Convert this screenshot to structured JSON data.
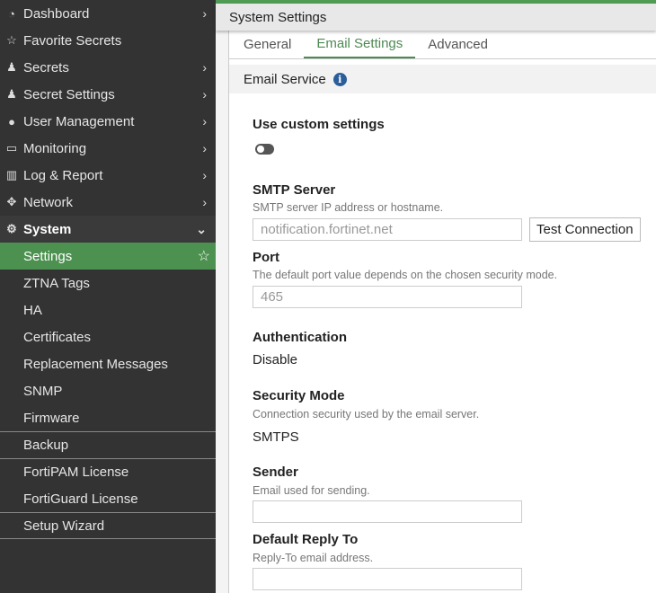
{
  "sidebar": {
    "items": [
      {
        "label": "Dashboard",
        "icon": "dashboard-icon",
        "glyph": "◔",
        "chev": "›"
      },
      {
        "label": "Favorite Secrets",
        "icon": "star-icon",
        "glyph": "☆",
        "chev": ""
      },
      {
        "label": "Secrets",
        "icon": "user-lock-icon",
        "glyph": "♟",
        "chev": "›"
      },
      {
        "label": "Secret Settings",
        "icon": "user-gear-icon",
        "glyph": "♟",
        "chev": "›"
      },
      {
        "label": "User Management",
        "icon": "user-icon",
        "glyph": "●",
        "chev": "›"
      },
      {
        "label": "Monitoring",
        "icon": "monitor-icon",
        "glyph": "▭",
        "chev": "›"
      },
      {
        "label": "Log & Report",
        "icon": "chart-icon",
        "glyph": "▥",
        "chev": "›"
      },
      {
        "label": "Network",
        "icon": "move-icon",
        "glyph": "✥",
        "chev": "›"
      }
    ],
    "system": {
      "label": "System",
      "glyph": "⚙",
      "chev": "⌄"
    },
    "sub": [
      "Settings",
      "ZTNA Tags",
      "HA",
      "Certificates",
      "Replacement Messages",
      "SNMP",
      "Firmware",
      "Backup",
      "FortiPAM License",
      "FortiGuard License",
      "Setup Wizard"
    ]
  },
  "header": {
    "title": "System Settings"
  },
  "tabs": [
    "General",
    "Email Settings",
    "Advanced"
  ],
  "section": {
    "title": "Email Service",
    "info": "i"
  },
  "form": {
    "custom": "Use custom settings",
    "smtp_label": "SMTP Server",
    "smtp_hint": "SMTP server IP address or hostname.",
    "smtp_value": "notification.fortinet.net",
    "test": "Test Connection",
    "port_label": "Port",
    "port_hint": "The default port value depends on the chosen security mode.",
    "port_value": "465",
    "auth_label": "Authentication",
    "auth_value": "Disable",
    "sec_label": "Security Mode",
    "sec_hint": "Connection security used by the email server.",
    "sec_value": "SMTPS",
    "sender_label": "Sender",
    "sender_hint": "Email used for sending.",
    "reply_label": "Default Reply To",
    "reply_hint": "Reply-To email address."
  }
}
